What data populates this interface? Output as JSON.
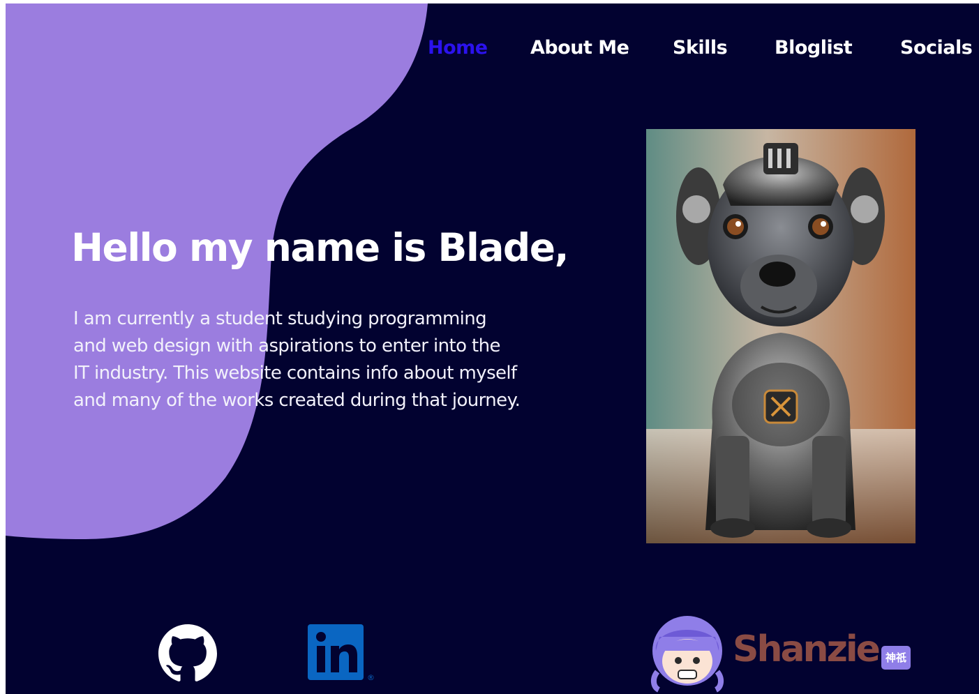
{
  "nav": {
    "items": [
      {
        "label": "Home",
        "active": true
      },
      {
        "label": "About Me",
        "active": false
      },
      {
        "label": "Skills",
        "active": false
      },
      {
        "label": "Bloglist",
        "active": false
      },
      {
        "label": "Socials",
        "active": false
      }
    ]
  },
  "hero": {
    "title": "Hello my name is Blade,",
    "description_lines": [
      "I am currently a student studying programming",
      "and web design with aspirations to enter into the",
      "IT industry. This website contains info about myself",
      "and many of the works created during that journey."
    ]
  },
  "photo": {
    "subject": "robot-dog-portrait"
  },
  "socials": {
    "github": {
      "icon": "github-icon"
    },
    "linkedin": {
      "icon": "linkedin-icon",
      "text": "in",
      "registered": "®"
    },
    "shanzie": {
      "word": "Shanzie",
      "badge": "神祇"
    }
  },
  "colors": {
    "background": "#020230",
    "blob": "#9b7ddf",
    "nav_active": "#2b12ee",
    "text": "#ffffff",
    "linkedin": "#0a66c2",
    "shanzie_word": "#8a4b44",
    "shanzie_badge": "#8f7ee8"
  }
}
